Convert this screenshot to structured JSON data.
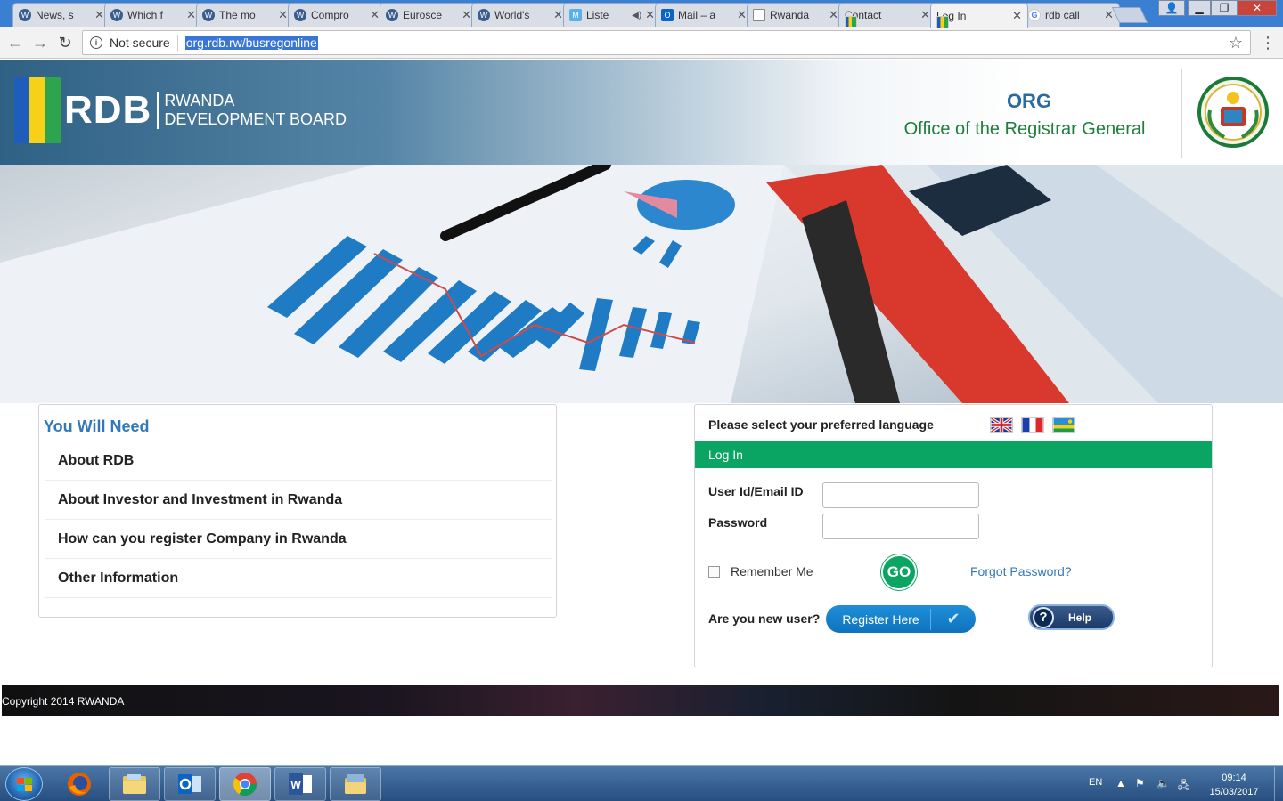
{
  "browser": {
    "tabs": [
      {
        "title": "News, s",
        "favicon": "wordpress-icon"
      },
      {
        "title": "Which f",
        "favicon": "wordpress-icon"
      },
      {
        "title": "The mo",
        "favicon": "wordpress-icon"
      },
      {
        "title": "Compro",
        "favicon": "wordpress-icon"
      },
      {
        "title": "Eurosce",
        "favicon": "wordpress-icon"
      },
      {
        "title": "World's",
        "favicon": "wordpress-icon"
      },
      {
        "title": "Liste",
        "favicon": "m-icon"
      },
      {
        "title": "Mail – a",
        "favicon": "outlook-icon"
      },
      {
        "title": "Rwanda",
        "favicon": "document-icon"
      },
      {
        "title": "Contact",
        "favicon": "rwanda-flag-icon"
      },
      {
        "title": "Log In",
        "favicon": "rwanda-flag-icon"
      },
      {
        "title": "rdb call",
        "favicon": "google-icon"
      }
    ],
    "active_tab_index": 10,
    "security_label": "Not secure",
    "url": "org.rdb.rw/busregonline"
  },
  "header": {
    "logo_text": "RDB",
    "logo_sub_line1": "RWANDA",
    "logo_sub_line2": "DEVELOPMENT BOARD",
    "org_title": "ORG",
    "org_subtitle": "Office of the Registrar General"
  },
  "need_panel": {
    "title": "You Will Need",
    "items": [
      "About RDB",
      "About Investor and Investment in Rwanda",
      "How can you register Company in Rwanda",
      "Other Information"
    ]
  },
  "login": {
    "language_prompt": "Please select your preferred language",
    "languages": [
      "English",
      "French",
      "Kinyarwanda"
    ],
    "bar_title": "Log In",
    "user_label": "User Id/Email ID",
    "user_value": "",
    "password_label": "Password",
    "password_value": "",
    "remember_label": "Remember Me",
    "go_label": "GO",
    "forgot_label": "Forgot Password?",
    "new_user_label": "Are you new user?",
    "register_label": "Register Here",
    "help_label": "Help"
  },
  "footer": {
    "copyright": "Copyright 2014 RWANDA"
  },
  "taskbar": {
    "language": "EN",
    "time": "09:14",
    "date": "15/03/2017"
  },
  "colors": {
    "login_bar": "#0aa562",
    "panel_title": "#3479b7",
    "org_subtitle": "#1e7d3a",
    "register_button": "#1480c9"
  }
}
